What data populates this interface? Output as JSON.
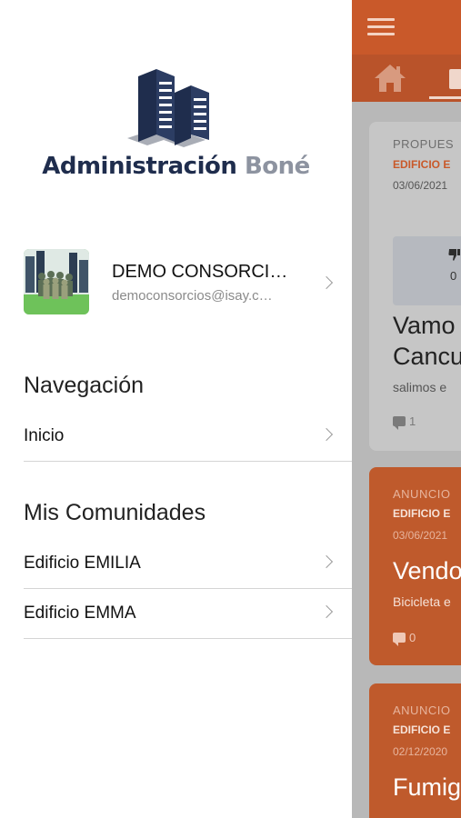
{
  "background_app": {
    "cards": [
      {
        "kind": "PROPUES",
        "community": "EDIFICIO E",
        "date": "03/06/2021",
        "vote_count": "0",
        "title_line1": "Vamo",
        "title_line2": "Cancu",
        "description": "salimos e",
        "comments": "1"
      },
      {
        "kind": "ANUNCIO",
        "community": "EDIFICIO E",
        "date": "03/06/2021",
        "title_line1": "Vendo",
        "description": "Bicicleta e",
        "comments": "0"
      },
      {
        "kind": "ANUNCIO",
        "community": "EDIFICIO E",
        "date": "02/12/2020",
        "title_line1": "Fumig"
      }
    ]
  },
  "drawer": {
    "logo": {
      "name": "Administración",
      "name_accent": "Boné"
    },
    "profile": {
      "name": "DEMO CONSORCI…",
      "email": "democonsorcios@isay.c…"
    },
    "navigation": {
      "title": "Navegación",
      "items": [
        {
          "label": "Inicio"
        }
      ]
    },
    "communities": {
      "title": "Mis Comunidades",
      "items": [
        {
          "label": "Edificio EMILIA"
        },
        {
          "label": "Edificio EMMA"
        }
      ]
    }
  },
  "colors": {
    "brand_orange": "#c9592a",
    "logo_navy": "#1f2d4d",
    "logo_gray": "#8d93a0"
  },
  "icons": [
    "menu-icon",
    "home-icon",
    "chevron-right-icon",
    "comment-icon",
    "thumbs-down-icon"
  ]
}
